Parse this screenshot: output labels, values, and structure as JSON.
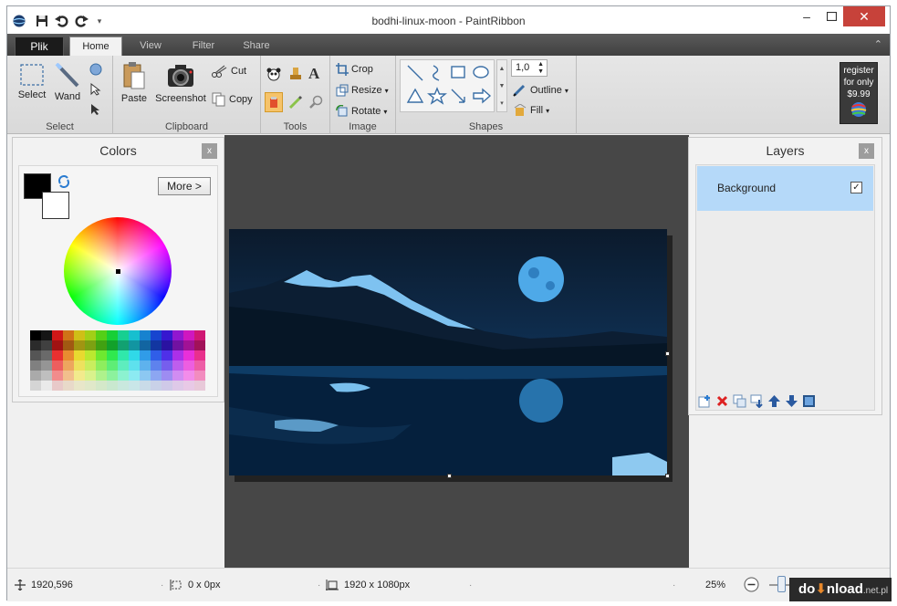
{
  "window": {
    "title": "bodhi-linux-moon - PaintRibbon"
  },
  "tabs": {
    "file": "Plik",
    "home": "Home",
    "view": "View",
    "filter": "Filter",
    "share": "Share"
  },
  "ribbon": {
    "select_group": {
      "label": "Select",
      "select": "Select",
      "wand": "Wand"
    },
    "clipboard_group": {
      "label": "Clipboard",
      "paste": "Paste",
      "screenshot": "Screenshot",
      "cut": "Cut",
      "copy": "Copy"
    },
    "tools_group": {
      "label": "Tools"
    },
    "image_group": {
      "label": "Image",
      "crop": "Crop",
      "resize": "Resize",
      "rotate": "Rotate"
    },
    "shapes_group": {
      "label": "Shapes",
      "size_value": "1,0",
      "outline": "Outline",
      "fill": "Fill"
    },
    "register": {
      "line1": "register",
      "line2": "for only",
      "line3": "$9.99"
    }
  },
  "colors_panel": {
    "title": "Colors",
    "more_button": "More >",
    "close": "x"
  },
  "layers_panel": {
    "title": "Layers",
    "close": "x",
    "layers": [
      {
        "name": "Background",
        "visible": true
      }
    ]
  },
  "status": {
    "position": "1920,596",
    "selection": "0 x 0px",
    "image_size": "1920 x 1080px",
    "zoom": "25%"
  },
  "watermark": {
    "prefix": "do",
    "suffix": "nload",
    "domain": ".net.pl"
  }
}
